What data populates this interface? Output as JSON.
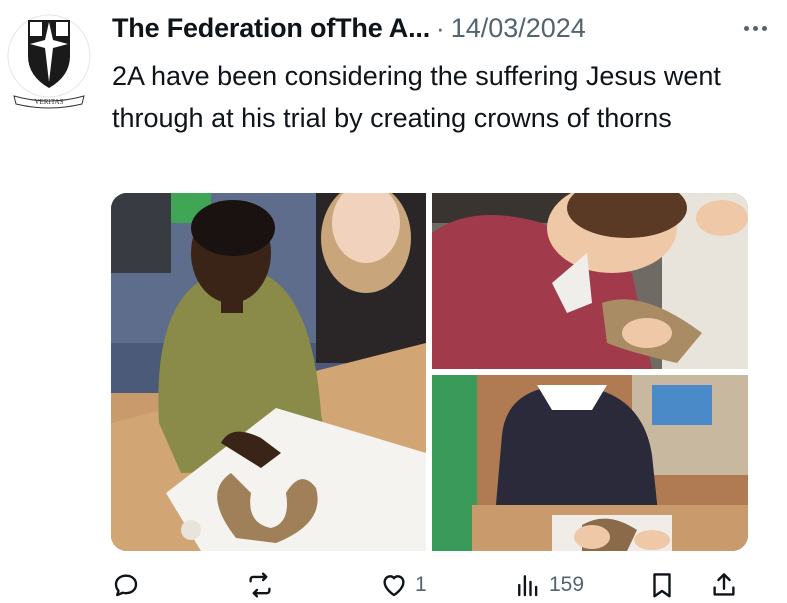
{
  "tweet": {
    "author_name": "The Federation ofThe A...",
    "separator": "·",
    "date": "14/03/2024",
    "avatar_motto": "VERITAS",
    "text": "2A have been considering the suffering Jesus went through at his trial by creating crowns of thorns"
  },
  "media": [
    {
      "icon": "photo-boy-making-crown"
    },
    {
      "icon": "photo-boy-cutting-paper"
    },
    {
      "icon": "photo-girl-weaving-crown"
    }
  ],
  "actions": {
    "reply_icon": "reply-icon",
    "retweet_icon": "retweet-icon",
    "like_icon": "heart-icon",
    "like_count": "1",
    "views_icon": "views-icon",
    "views_count": "159",
    "bookmark_icon": "bookmark-icon",
    "share_icon": "share-icon"
  },
  "colors": {
    "text": "#0f1419",
    "secondary": "#536471",
    "background": "#ffffff"
  }
}
